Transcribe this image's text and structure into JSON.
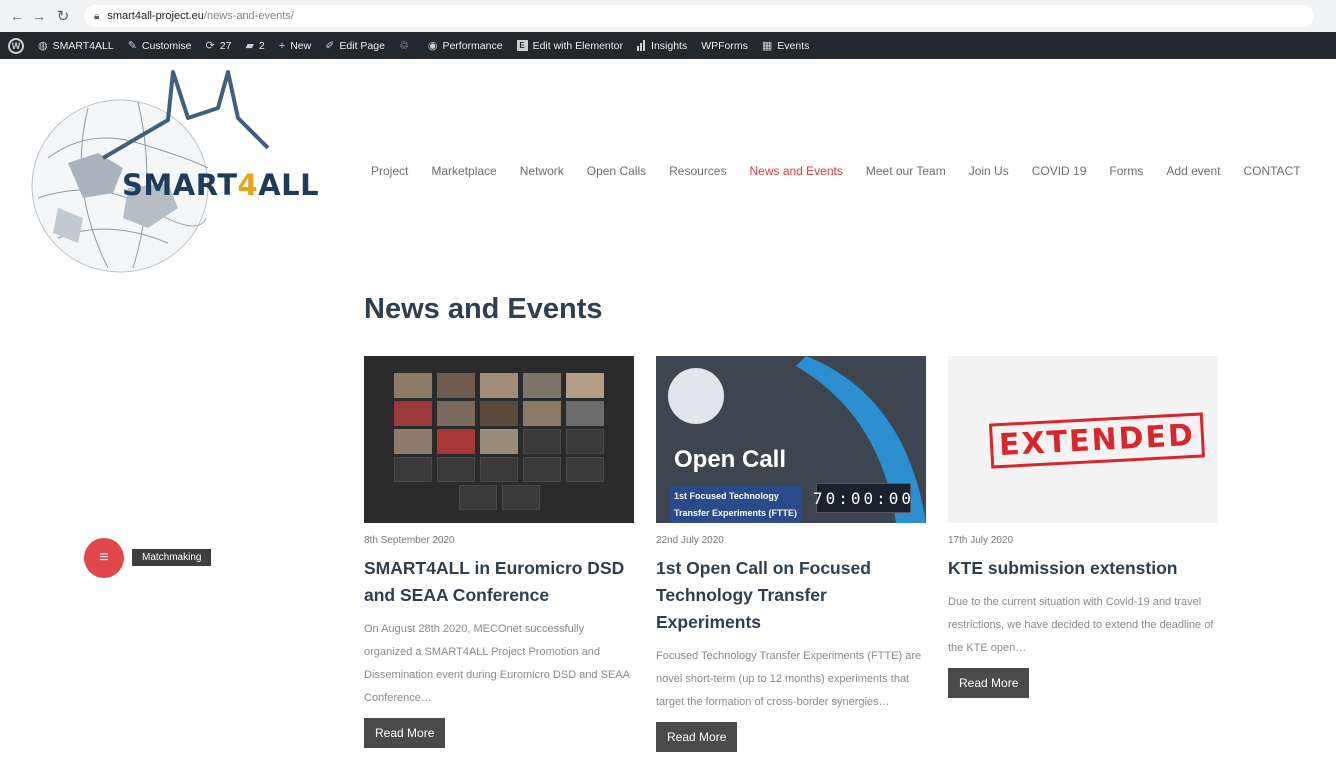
{
  "browser": {
    "url_host": "smart4all-project.eu",
    "url_path": "/news-and-events/"
  },
  "adminbar": {
    "site_name": "SMART4ALL",
    "customise": "Customise",
    "updates_count": "27",
    "comments_count": "2",
    "new": "New",
    "edit_page": "Edit Page",
    "performance": "Performance",
    "edit_elementor": "Edit with Elementor",
    "insights": "Insights",
    "wpforms": "WPForms",
    "events": "Events"
  },
  "logo": {
    "text_a": "SMART",
    "text_b": "4",
    "text_c": "ALL"
  },
  "nav": [
    {
      "label": "Project"
    },
    {
      "label": "Marketplace"
    },
    {
      "label": "Network"
    },
    {
      "label": "Open Calls"
    },
    {
      "label": "Resources"
    },
    {
      "label": "News and Events",
      "active": true
    },
    {
      "label": "Meet our Team"
    },
    {
      "label": "Join Us"
    },
    {
      "label": "COVID 19"
    },
    {
      "label": "Forms"
    },
    {
      "label": "Add event"
    },
    {
      "label": "CONTACT"
    }
  ],
  "page_title": "News and Events",
  "posts": [
    {
      "date": "8th September 2020",
      "title": "SMART4ALL in Euromicro DSD and SEAA Conference",
      "excerpt": "On August 28th 2020, MECOnet successfully organized a SMART4ALL Project Promotion and Dissemination event during Euromicro DSD and SEAA Conference…",
      "button": "Read More"
    },
    {
      "date": "22nd July 2020",
      "title": "1st Open Call on Focused Technology Transfer Experiments",
      "excerpt": "Focused Technology Transfer Experiments (FTTE) are novel short-term (up to 12 months) experiments that target the formation of cross-border synergies…",
      "button": "Read More",
      "image_title": "Open Call",
      "image_subtitle_1": "1st Focused Technology",
      "image_subtitle_2": "Transfer Experiments (FTTE)",
      "image_counter": "70:00:00"
    },
    {
      "date": "17th July 2020",
      "title": "KTE submission extenstion",
      "excerpt": "Due to the current situation with Covid-19 and travel restrictions, we have decided to extend the deadline of the KTE open…",
      "button": "Read More",
      "image_stamp": "EXTENDED"
    }
  ],
  "matchmaking": {
    "label": "Matchmaking"
  },
  "colors": {
    "accent": "#e0383b",
    "title": "#2f3f4f",
    "adminbar": "#23282d",
    "button": "#4a4a4a"
  }
}
